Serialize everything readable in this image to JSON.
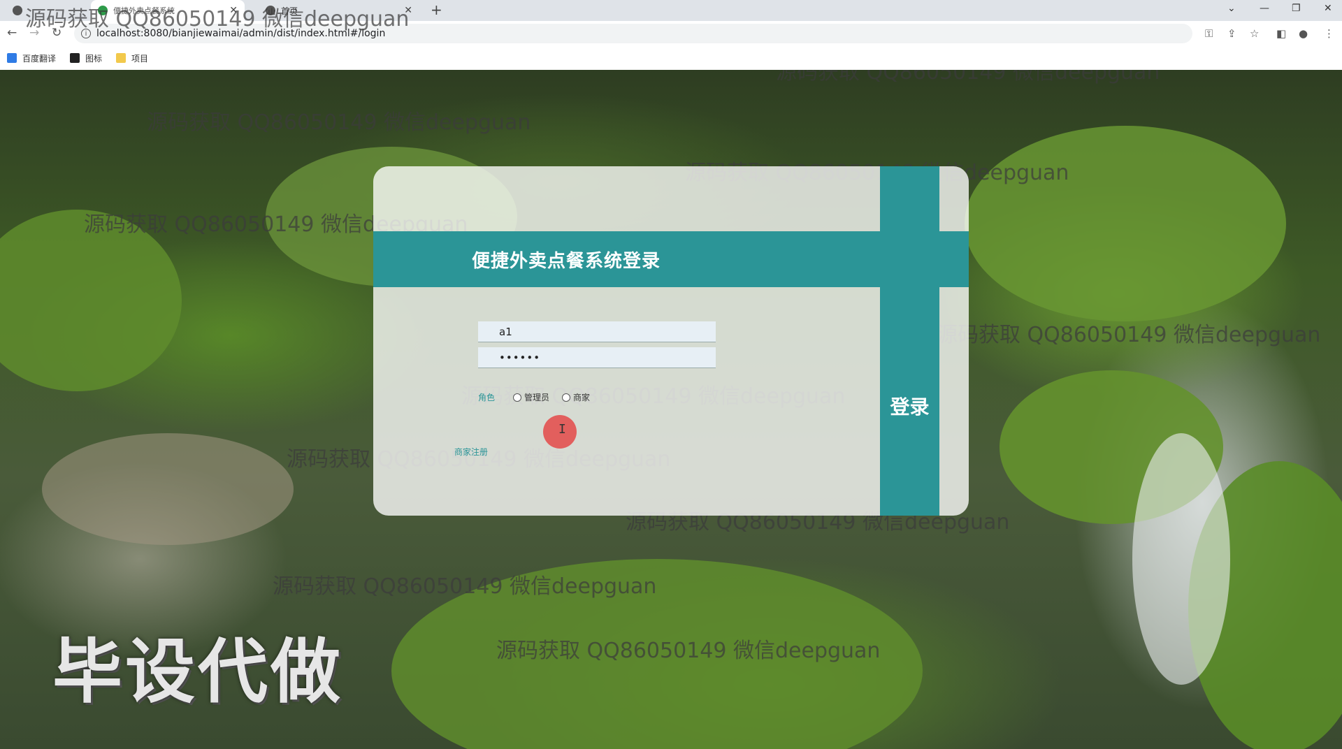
{
  "browser": {
    "tabs": [
      {
        "label": "源码获取 QQ86050149 微信deepguan",
        "active": false
      },
      {
        "label": "便捷外卖点餐系统",
        "active": true
      },
      {
        "label": "首页",
        "active": false
      }
    ],
    "new_tab": "+",
    "url": "localhost:8080/bianjiewaimai/admin/dist/index.html#/login",
    "bookmarks": [
      {
        "label": "百度翻译",
        "icon": "translate-icon"
      },
      {
        "label": "图标",
        "icon": "image-icon"
      },
      {
        "label": "项目",
        "icon": "folder-icon"
      }
    ]
  },
  "login": {
    "title": "便捷外卖点餐系统登录",
    "username_value": "a1",
    "password_value": "••••••",
    "role_label": "角色",
    "roles": [
      "管理员",
      "商家"
    ],
    "register_link": "商家注册",
    "login_button": "登录",
    "accent_color": "#2b9597"
  },
  "overlay": {
    "watermark": "源码获取 QQ86050149 微信deepguan",
    "brand_text": "毕设代做"
  }
}
